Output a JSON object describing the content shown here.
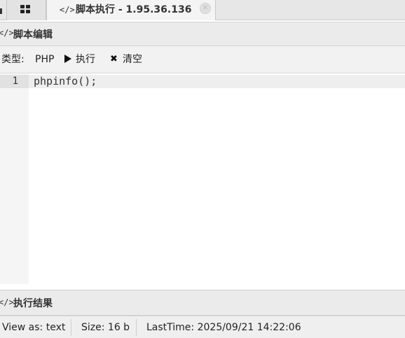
{
  "tab": {
    "title": "脚本执行 - 1.95.36.136",
    "code_icon": "code-icon",
    "close_icon": "close-icon"
  },
  "editor_panel": {
    "title": "脚本编辑",
    "icon_glyph": "</>"
  },
  "toolbar": {
    "type_label": "类型:",
    "type_value": "PHP",
    "run_label": "执行",
    "clear_label": "清空"
  },
  "editor": {
    "line_number": "1",
    "code": "phpinfo();"
  },
  "result_panel": {
    "title": "执行结果",
    "icon_glyph": "</>"
  },
  "status": {
    "view_as": "View as: text",
    "size": "Size: 16 b",
    "last_time": "LastTime: 2025/09/21 14:22:06"
  }
}
